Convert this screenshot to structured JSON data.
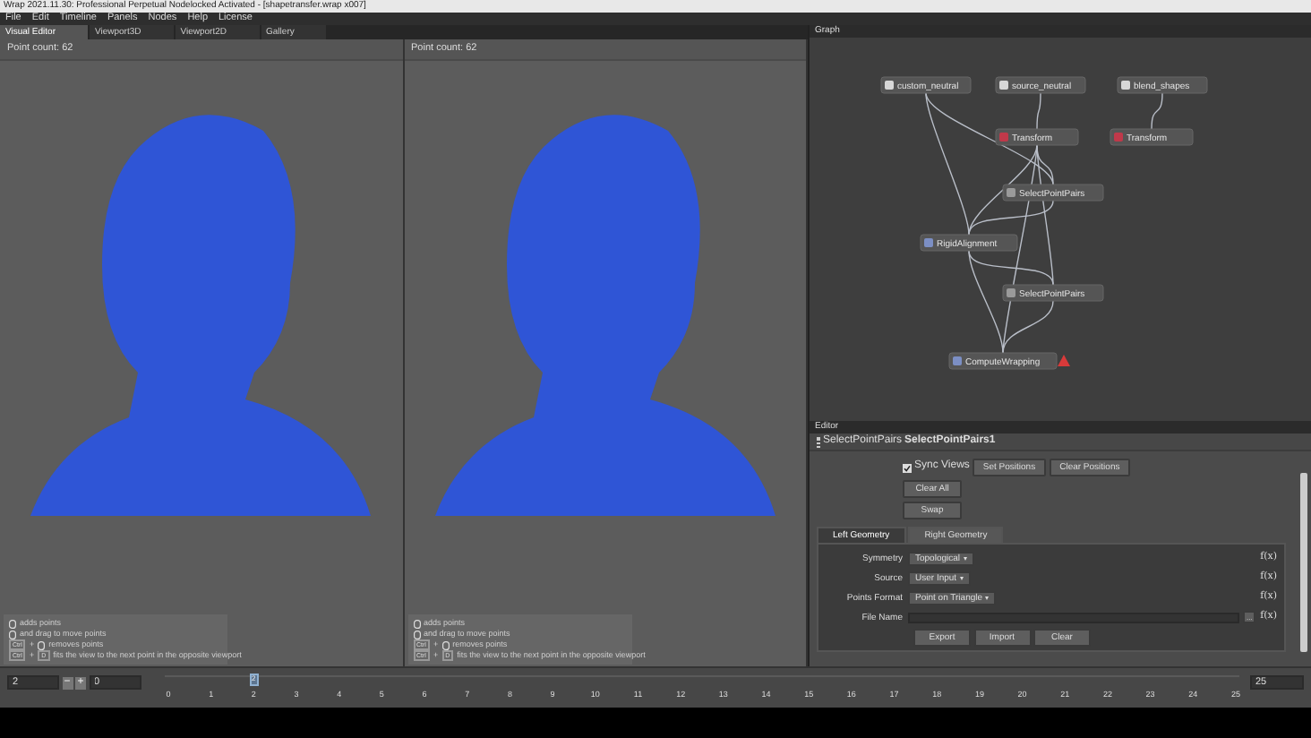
{
  "window": {
    "title": "Wrap 2021.11.30: Professional Perpetual Nodelocked Activated - [shapetransfer.wrap x007]"
  },
  "menu": [
    "File",
    "Edit",
    "Timeline",
    "Panels",
    "Nodes",
    "Help",
    "License"
  ],
  "tabs": [
    {
      "label": "Visual Editor",
      "selected": true
    },
    {
      "label": "Viewport3D",
      "selected": false
    },
    {
      "label": "Viewport2D",
      "selected": false
    },
    {
      "label": "Gallery",
      "selected": false
    }
  ],
  "viewports": [
    {
      "point_count": "Point count: 62",
      "hints": [
        [
          {
            "kind": "mouse"
          },
          {
            "kind": "text",
            "text": "adds points"
          }
        ],
        [
          {
            "kind": "mouse"
          },
          {
            "kind": "text",
            "text": "and drag to move points"
          }
        ],
        [
          {
            "kind": "key",
            "text": "Ctrl"
          },
          {
            "kind": "text",
            "text": "+"
          },
          {
            "kind": "mouse"
          },
          {
            "kind": "text",
            "text": "removes points"
          }
        ],
        [
          {
            "kind": "key",
            "text": "Ctrl"
          },
          {
            "kind": "text",
            "text": "+"
          },
          {
            "kind": "key",
            "text": "D"
          },
          {
            "kind": "text",
            "text": "fits the view to the next point in the opposite viewport"
          }
        ]
      ]
    },
    {
      "point_count": "Point count: 62",
      "hints": [
        [
          {
            "kind": "mouse"
          },
          {
            "kind": "text",
            "text": "adds points"
          }
        ],
        [
          {
            "kind": "mouse"
          },
          {
            "kind": "text",
            "text": "and drag to move points"
          }
        ],
        [
          {
            "kind": "key",
            "text": "Ctrl"
          },
          {
            "kind": "text",
            "text": "+"
          },
          {
            "kind": "mouse"
          },
          {
            "kind": "text",
            "text": "removes points"
          }
        ],
        [
          {
            "kind": "key",
            "text": "Ctrl"
          },
          {
            "kind": "text",
            "text": "+"
          },
          {
            "kind": "key",
            "text": "D"
          },
          {
            "kind": "text",
            "text": "fits the view to the next point in the opposite viewport"
          }
        ]
      ]
    }
  ],
  "graph": {
    "title": "Graph",
    "nodes": [
      {
        "label": "custom_neutral",
        "kind": "geometry",
        "warning": false
      },
      {
        "label": "source_neutral",
        "kind": "geometry",
        "warning": false
      },
      {
        "label": "blend_shapes",
        "kind": "geometry",
        "warning": false
      },
      {
        "label": "Transform",
        "kind": "transform",
        "warning": false
      },
      {
        "label": "Transform",
        "kind": "transform",
        "warning": false
      },
      {
        "label": "SelectPointPairs",
        "kind": "select",
        "warning": false
      },
      {
        "label": "RigidAlignment",
        "kind": "align",
        "warning": false
      },
      {
        "label": "SelectPointPairs",
        "kind": "select",
        "warning": false
      },
      {
        "label": "ComputeWrapping",
        "kind": "align",
        "warning": true
      }
    ]
  },
  "editor": {
    "title": "Editor",
    "node_type": "SelectPointPairs",
    "node_name": "SelectPointPairs1",
    "sync_views": {
      "label": "Sync Views",
      "checked": true
    },
    "buttons_top": [
      "Set Positions",
      "Clear Positions"
    ],
    "buttons_stack": [
      "Clear All",
      "Swap"
    ],
    "geometry_tabs": [
      {
        "label": "Left Geometry",
        "selected": true
      },
      {
        "label": "Right Geometry",
        "selected": false
      }
    ],
    "fields": [
      {
        "label": "Symmetry",
        "kind": "select",
        "value": "Topological",
        "fx": "f(x)"
      },
      {
        "label": "Source",
        "kind": "select",
        "value": "User Input",
        "fx": "f(x)"
      },
      {
        "label": "Points Format",
        "kind": "select",
        "value": "Point on Triangle",
        "fx": "f(x)"
      },
      {
        "label": "File Name",
        "kind": "file",
        "browse": "...",
        "fx": "f(x)"
      }
    ],
    "buttons_bottom": [
      "Export",
      "Import",
      "Clear"
    ]
  },
  "timeline": {
    "current": "2",
    "minus": "−",
    "plus": "+",
    "start": "0",
    "end": "25",
    "ticks": [
      "0",
      "1",
      "2",
      "3",
      "4",
      "5",
      "6",
      "7",
      "8",
      "9",
      "10",
      "11",
      "12",
      "13",
      "14",
      "15",
      "16",
      "17",
      "18",
      "19",
      "20",
      "21",
      "22",
      "23",
      "24",
      "25"
    ],
    "marker": "2",
    "level": 0.08
  }
}
